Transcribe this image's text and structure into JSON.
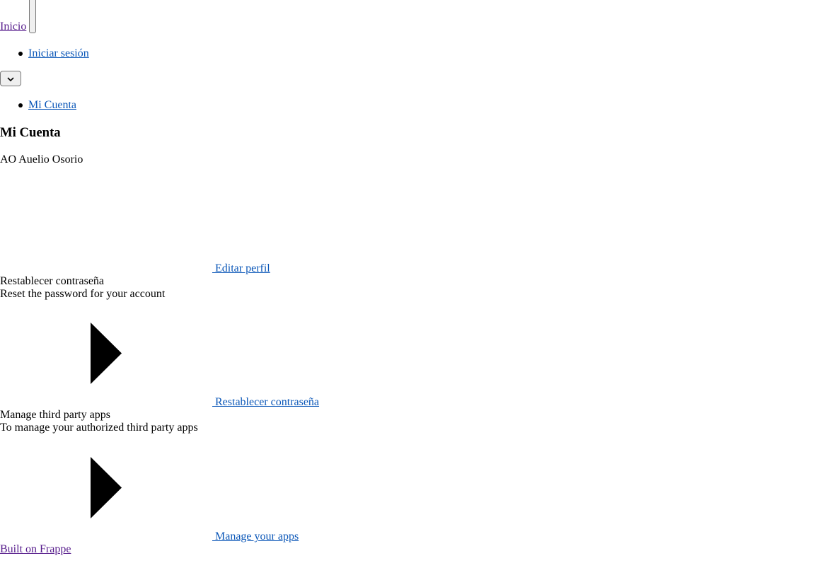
{
  "header": {
    "home_link": "Inicio",
    "login_link": "Iniciar sesión",
    "breadcrumb_link": "Mi Cuenta"
  },
  "page": {
    "title": "Mi Cuenta"
  },
  "profile": {
    "initials": "AO",
    "name": "Auelio Osorio",
    "edit_link": "Editar perfil"
  },
  "sections": [
    {
      "title": "Restablecer contraseña",
      "description": "Reset the password for your account",
      "action_link": "Restablecer contraseña",
      "icon": "chevron-right-icon"
    },
    {
      "title": "Manage third party apps",
      "description": "To manage your authorized third party apps",
      "action_link": "Manage your apps",
      "icon": "chevron-right-icon"
    }
  ],
  "footer": {
    "built_on_link": "Built on Frappe"
  }
}
